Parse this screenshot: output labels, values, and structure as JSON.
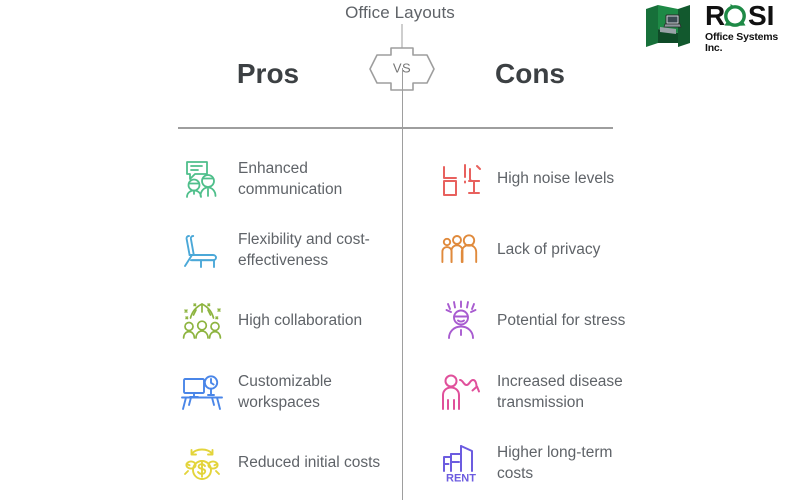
{
  "title": "Office Layouts",
  "vs_label": "VS",
  "columns": {
    "pros_header": "Pros",
    "cons_header": "Cons"
  },
  "colors": {
    "text": "#5f6368",
    "heading": "#3c4043",
    "divider": "#9e9e9e",
    "pro_1": "#4FBF8B",
    "pro_2": "#4BA8D8",
    "pro_3": "#8DB43F",
    "pro_4": "#4A86E8",
    "pro_5": "#E3D43B",
    "con_1": "#E8615E",
    "con_2": "#E08A3C",
    "con_3": "#A85BD0",
    "con_4": "#E0509B",
    "con_5": "#6C5CE0",
    "logo_green": "#17703A"
  },
  "pros": [
    {
      "label": "Enhanced communication",
      "icon": "speech-bubble-people-icon",
      "color": "#4FBF8B"
    },
    {
      "label": "Flexibility and cost-effectiveness",
      "icon": "lounge-chair-icon",
      "color": "#4BA8D8"
    },
    {
      "label": "High collaboration",
      "icon": "celebrating-group-icon",
      "color": "#8DB43F"
    },
    {
      "label": "Customizable workspaces",
      "icon": "desk-monitor-clock-icon",
      "color": "#4A86E8"
    },
    {
      "label": "Reduced initial costs",
      "icon": "money-recycle-icon",
      "color": "#E3D43B"
    }
  ],
  "cons": [
    {
      "label": "High noise levels",
      "icon": "desk-chair-alert-icon",
      "color": "#E8615E"
    },
    {
      "label": "Lack of privacy",
      "icon": "crowd-people-icon",
      "color": "#E08A3C"
    },
    {
      "label": "Potential for stress",
      "icon": "stressed-person-icon",
      "color": "#A85BD0"
    },
    {
      "label": "Increased disease transmission",
      "icon": "person-virus-spread-icon",
      "color": "#E0509B"
    },
    {
      "label": "Higher long-term costs",
      "icon": "rent-building-icon",
      "color": "#6C5CE0"
    }
  ],
  "logo": {
    "brand": "ROSI",
    "tagline": "Office Systems Inc.",
    "mark": "office-cubicle-icon"
  }
}
